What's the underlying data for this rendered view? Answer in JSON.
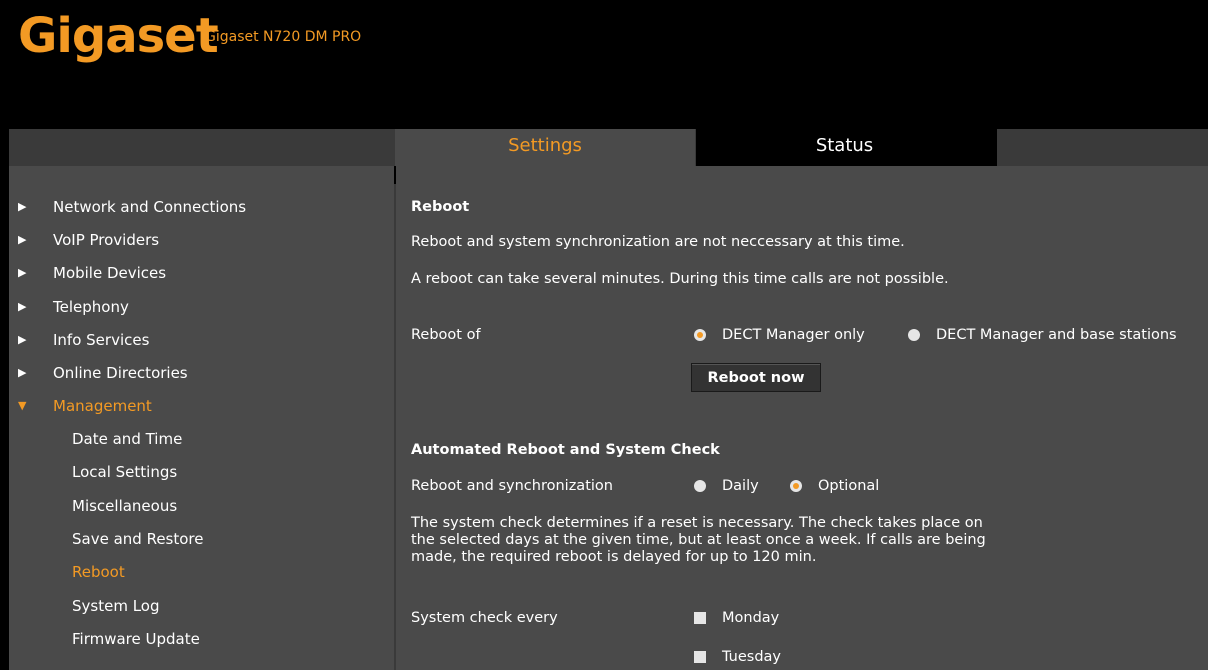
{
  "header": {
    "logo": "Gigaset",
    "model": "Gigaset N720 DM PRO"
  },
  "tabs": [
    {
      "label": "Settings",
      "active": true
    },
    {
      "label": "Status",
      "active": false
    }
  ],
  "sidebar": {
    "items": [
      {
        "label": "Network and Connections",
        "arrow": "▶"
      },
      {
        "label": "VoIP Providers",
        "arrow": "▶"
      },
      {
        "label": "Mobile Devices",
        "arrow": "▶"
      },
      {
        "label": "Telephony",
        "arrow": "▶"
      },
      {
        "label": "Info Services",
        "arrow": "▶"
      },
      {
        "label": "Online Directories",
        "arrow": "▶"
      },
      {
        "label": "Management",
        "arrow": "▼",
        "active": true
      }
    ],
    "subitems": [
      {
        "label": "Date and Time"
      },
      {
        "label": "Local Settings"
      },
      {
        "label": "Miscellaneous"
      },
      {
        "label": "Save and Restore"
      },
      {
        "label": "Reboot",
        "active": true
      },
      {
        "label": "System Log"
      },
      {
        "label": "Firmware Update"
      }
    ]
  },
  "main": {
    "reboot": {
      "title": "Reboot",
      "status": "Reboot and system synchronization are not neccessary at this time.",
      "warning": "A reboot can take several minutes. During this time calls are not possible.",
      "reboot_of_label": "Reboot of",
      "options": [
        {
          "label": "DECT Manager only",
          "selected": true
        },
        {
          "label": "DECT Manager and base stations",
          "selected": false
        }
      ],
      "button": "Reboot now"
    },
    "auto": {
      "title": "Automated Reboot and System Check",
      "sync_label": "Reboot and synchronization",
      "options": [
        {
          "label": "Daily",
          "selected": false
        },
        {
          "label": "Optional",
          "selected": true
        }
      ],
      "description": "The system check determines if a reset is necessary. The check takes place on the selected days at the given time, but at least once a week. If calls are being made, the required reboot is delayed for up to 120 min.",
      "every_label": "System check every",
      "days": [
        {
          "label": "Monday",
          "checked": false
        },
        {
          "label": "Tuesday",
          "checked": false
        }
      ]
    }
  },
  "colors": {
    "accent": "#f39a24",
    "panel": "#4a4a4a",
    "background": "#000000"
  }
}
